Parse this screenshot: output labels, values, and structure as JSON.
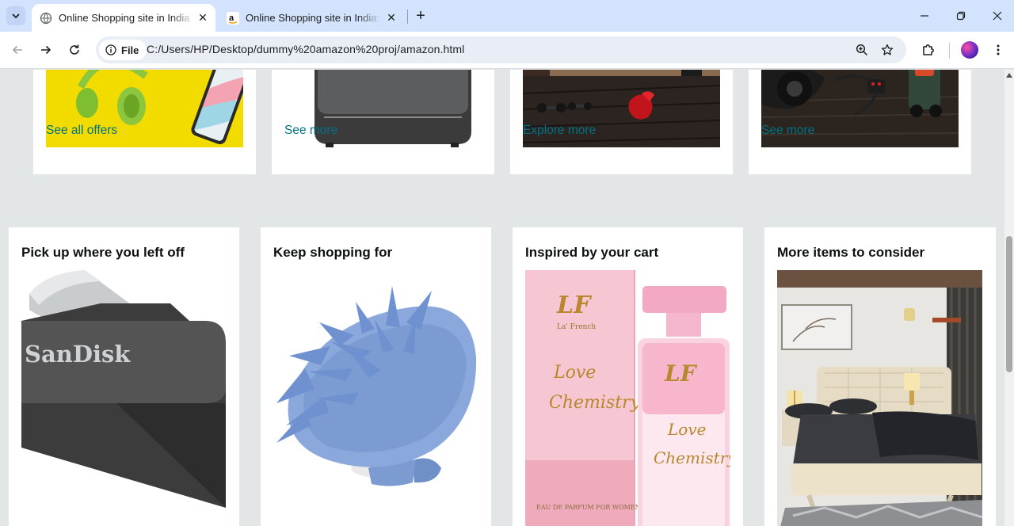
{
  "browser": {
    "tabs": [
      {
        "title": "Online Shopping site in India - Shop Online",
        "active": true
      },
      {
        "title": "Online Shopping site in India: Shop Online",
        "active": false
      }
    ],
    "new_tab_symbol": "+",
    "close_symbol": "✕",
    "omnibox": {
      "chip_label": "File",
      "url": "C:/Users/HP/Desktop/dummy%20amazon%20proj/amazon.html"
    }
  },
  "page": {
    "top_cards": [
      {
        "link": "See all offers",
        "image": "headphones-and-phone-on-yellow"
      },
      {
        "link": "See more",
        "image": "luggage-trolley"
      },
      {
        "link": "Explore more",
        "image": "home-gym-dumbbells-and-boxing-glove"
      },
      {
        "link": "See more",
        "image": "car-accessories-pressure-washer"
      }
    ],
    "cards": [
      {
        "title": "Pick up where you left off",
        "image": "sandisk-usb-drive",
        "brand_text": "SanDisk"
      },
      {
        "title": "Keep shopping for",
        "image": "blue-scalp-massager-brush"
      },
      {
        "title": "Inspired by your cart",
        "image": "love-chemistry-perfume",
        "box_brand": "LF",
        "box_sub": "La' French",
        "product_line1": "Love",
        "product_line2": "Chemistry",
        "fine_print": "EAU DE PARFUM FOR WOMEN"
      },
      {
        "title": "More items to consider",
        "image": "bedroom-double-bed"
      }
    ]
  },
  "colors": {
    "page_bg": "#e3e6e6",
    "link": "#007185",
    "tabstrip": "#d3e3fd",
    "heading": "#0f1111"
  }
}
